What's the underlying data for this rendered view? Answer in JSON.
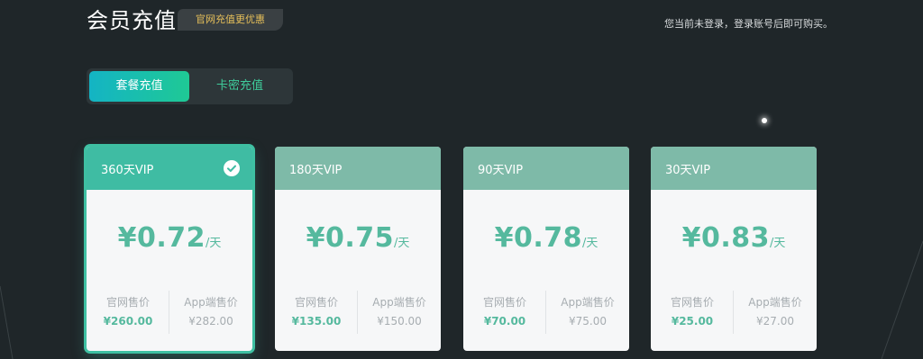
{
  "header": {
    "title": "会员充值",
    "promo_badge": "官网充值更优惠",
    "login_hint": "您当前未登录，登录账号后即可购买。"
  },
  "tabs": [
    {
      "label": "套餐充值",
      "active": true
    },
    {
      "label": "卡密充值",
      "active": false
    }
  ],
  "plans": [
    {
      "name": "360天VIP",
      "price": "¥0.72",
      "unit": "/天",
      "official_label": "官网售价",
      "official_price": "¥260.00",
      "app_label": "App端售价",
      "app_price": "¥282.00",
      "selected": true
    },
    {
      "name": "180天VIP",
      "price": "¥0.75",
      "unit": "/天",
      "official_label": "官网售价",
      "official_price": "¥135.00",
      "app_label": "App端售价",
      "app_price": "¥150.00",
      "selected": false
    },
    {
      "name": "90天VIP",
      "price": "¥0.78",
      "unit": "/天",
      "official_label": "官网售价",
      "official_price": "¥70.00",
      "app_label": "App端售价",
      "app_price": "¥75.00",
      "selected": false
    },
    {
      "name": "30天VIP",
      "price": "¥0.83",
      "unit": "/天",
      "official_label": "官网售价",
      "official_price": "¥25.00",
      "app_label": "App端售价",
      "app_price": "¥27.00",
      "selected": false
    }
  ],
  "icons": {
    "selected_indicator": "check-circle-icon"
  },
  "colors": {
    "background": "#1f2629",
    "accent_green": "#3fbca3",
    "price_green": "#55b99e",
    "card_header": "#7ebaa8",
    "promo_gold": "#e6bf5a",
    "tab_gradient_start": "#14b4c4",
    "tab_gradient_end": "#1fc995"
  }
}
